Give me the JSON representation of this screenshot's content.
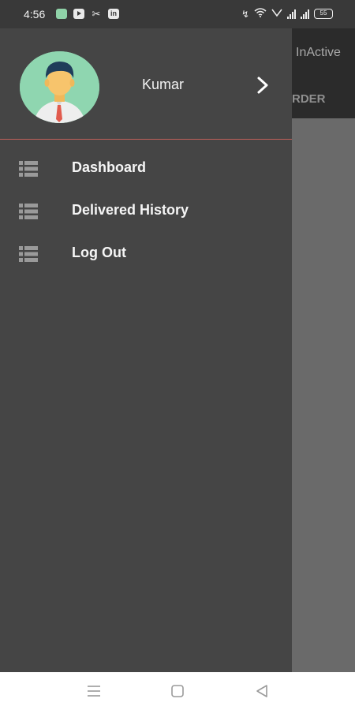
{
  "status_bar": {
    "time": "4:56",
    "app_icons": [
      "messages-icon",
      "youtube-icon",
      "tools-icon",
      "linkedin-icon"
    ],
    "battery": "55",
    "linkedin_text": "in"
  },
  "background_app": {
    "tab_inactive": "InActive",
    "order_label": "RDER"
  },
  "drawer": {
    "profile": {
      "name": "Kumar"
    },
    "accent_line_color": "#c1605a",
    "items": [
      {
        "label": "Dashboard"
      },
      {
        "label": "Delivered History"
      },
      {
        "label": "Log Out"
      }
    ]
  }
}
